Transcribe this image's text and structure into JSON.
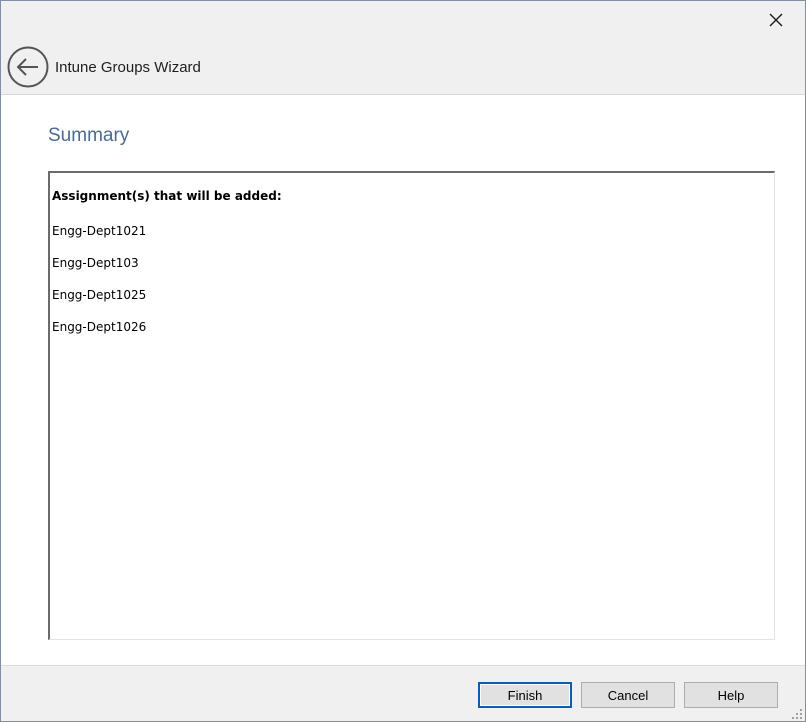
{
  "window": {
    "title": "Intune Groups Wizard",
    "close_icon": "close-icon",
    "back_icon": "back-arrow-icon"
  },
  "page": {
    "heading": "Summary"
  },
  "summary": {
    "heading": "Assignment(s) that will be added:",
    "items": [
      "Engg-Dept1021",
      "Engg-Dept103",
      "Engg-Dept1025",
      "Engg-Dept1026"
    ]
  },
  "footer": {
    "finish_label": "Finish",
    "cancel_label": "Cancel",
    "help_label": "Help"
  },
  "colors": {
    "heading_accent": "#4a6a93",
    "header_background": "#f0f0f0",
    "default_button_border": "#0f5da8"
  }
}
